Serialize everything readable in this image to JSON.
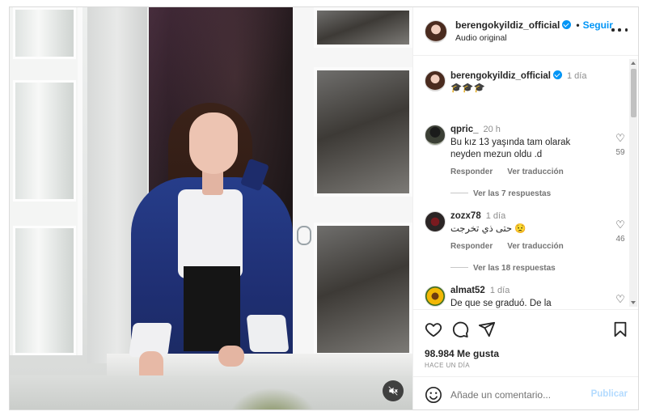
{
  "post": {
    "username": "berengokyildiz_official",
    "follow_label": "Seguir",
    "audio_label": "Audio original"
  },
  "caption": {
    "username": "berengokyildiz_official",
    "time": "1 día",
    "text": "🎓🎓🎓"
  },
  "comments": [
    {
      "username": "qpric_",
      "time": "20 h",
      "text": "Bu kız 13 yaşında tam olarak neyden mezun oldu .d",
      "likes": "59",
      "reply_label": "Responder",
      "translate_label": "Ver traducción",
      "replies_label": "Ver las 7 respuestas"
    },
    {
      "username": "zozx78",
      "time": "1 día",
      "text": "حتى ذي تخرجت 😟",
      "likes": "46",
      "reply_label": "Responder",
      "translate_label": "Ver traducción",
      "replies_label": "Ver las 18 respuestas"
    },
    {
      "username": "almat52",
      "time": "1 día",
      "text": "De que se graduó. De la secundaria. Muchas felicidades 😊 por su",
      "likes": ""
    }
  ],
  "footer": {
    "likes_text": "98.984 Me gusta",
    "ago_text": "HACE UN DÍA",
    "comment_placeholder": "Añade un comentario...",
    "publish_label": "Publicar"
  },
  "icons": {
    "like": "heart-icon",
    "comment": "comment-icon",
    "share": "paper-plane-icon",
    "save": "bookmark-icon",
    "emoji": "emoji-icon",
    "more": "more-options-icon",
    "mute": "sound-off-icon",
    "verified": "verified-badge-icon"
  },
  "colors": {
    "accent": "#0095f6",
    "publish_disabled": "#b3dbff",
    "text": "#262626",
    "muted": "#737373"
  }
}
